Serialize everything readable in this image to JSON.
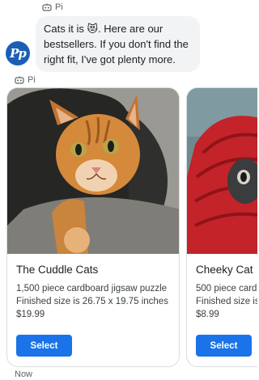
{
  "message_header": {
    "sender": "Pi",
    "icon": "pi-agent-icon"
  },
  "message": {
    "text_before_emoji": "Cats it is ",
    "emoji": "😻",
    "text_after_emoji": ". Here are our bestsellers. If you don't find the right fit, I've got plenty more."
  },
  "avatar": {
    "initials": "Pp",
    "color": "#1b5fb5"
  },
  "carousel_header": {
    "sender": "Pi",
    "icon": "pi-agent-icon"
  },
  "products": [
    {
      "title": "The Cuddle Cats",
      "desc_line1": "1,500 piece cardboard jigsaw puzzle",
      "desc_line2": "Finished size is 26.75 x 19.75 inches",
      "price": "$19.99",
      "button_label": "Select",
      "image": "orange-tabby-cat-photo"
    },
    {
      "title": "Cheeky Cat",
      "desc_line1": "500 piece card",
      "desc_line2": "Finished size is",
      "price": "$8.99",
      "button_label": "Select",
      "image": "cat-in-red-knit-hat-photo"
    }
  ],
  "timestamp": "Now",
  "colors": {
    "accent": "#1a73e8",
    "bubble": "#f1f3f4",
    "muted_text": "#5f6368"
  }
}
